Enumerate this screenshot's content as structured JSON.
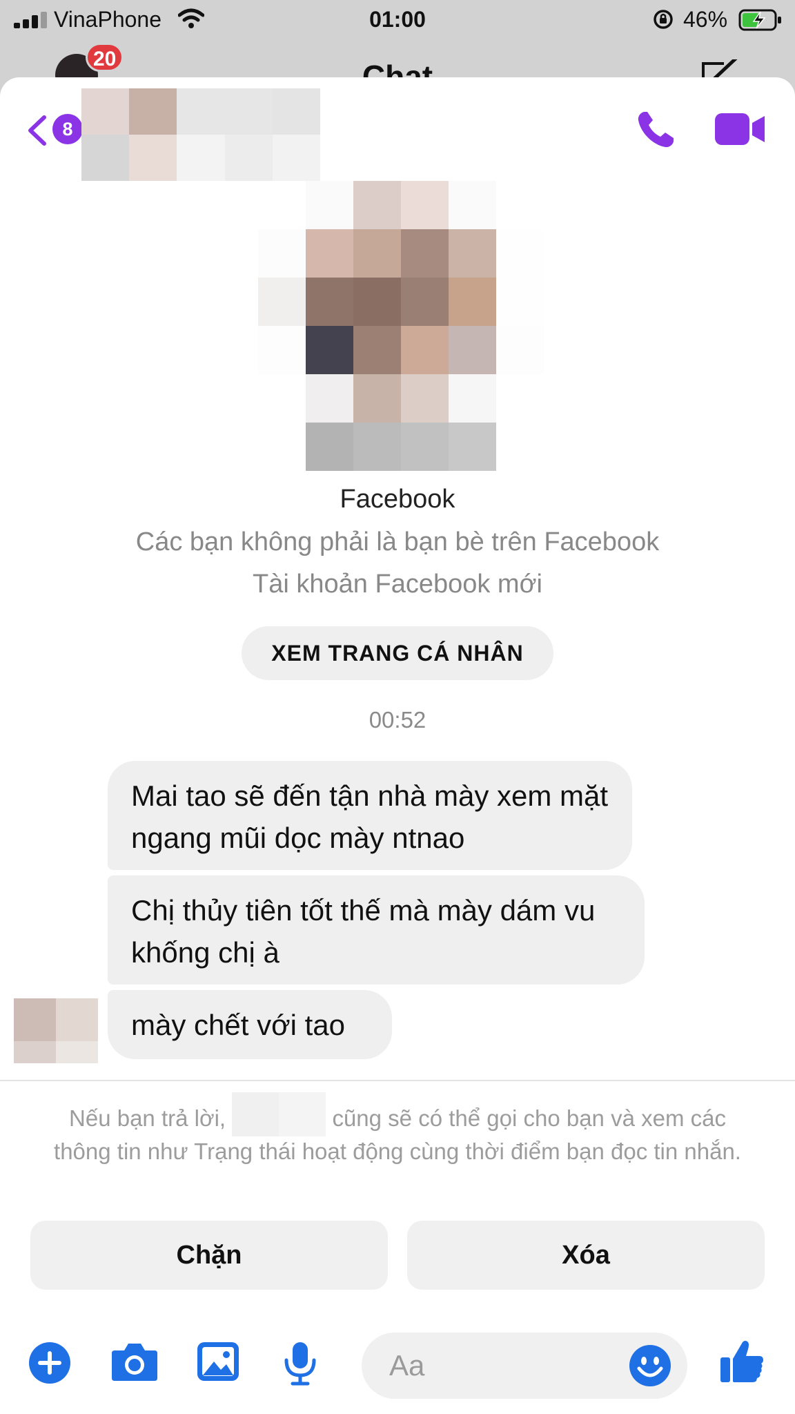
{
  "status_bar": {
    "carrier": "VinaPhone",
    "time": "01:00",
    "battery": "46%"
  },
  "background": {
    "title": "Chat",
    "unread_badge": "20"
  },
  "header": {
    "back_count": "8",
    "icons": [
      "chevron-left-icon",
      "phone-icon",
      "video-camera-icon"
    ],
    "accent_color": "#8b34e6"
  },
  "profile": {
    "source": "Facebook",
    "note_friends": "Các bạn không phải là bạn bè trên Facebook",
    "note_account": "Tài khoản Facebook mới",
    "view_profile_label": "XEM TRANG CÁ NHÂN"
  },
  "conversation": {
    "timestamp": "00:52",
    "messages": [
      {
        "text": "Mai tao sẽ đến tận nhà mày xem mặt ngang mũi dọc mày ntnao"
      },
      {
        "text": "Chị thủy tiên tốt thế mà mày dám vu khống chị à"
      },
      {
        "text": "mày chết với tao"
      }
    ]
  },
  "request_notice": {
    "part1": "Nếu bạn trả lời,",
    "part2": "cũng sẽ có thể gọi cho bạn và xem các thông tin như Trạng thái hoạt động cùng thời điểm bạn đọc tin nhắn."
  },
  "actions": {
    "block_label": "Chặn",
    "delete_label": "Xóa"
  },
  "composer": {
    "placeholder": "Aa",
    "accent_color": "#1f6fe5",
    "icons": [
      "plus-circle-icon",
      "camera-icon",
      "image-icon",
      "microphone-icon",
      "emoji-icon",
      "thumbs-up-icon"
    ]
  }
}
